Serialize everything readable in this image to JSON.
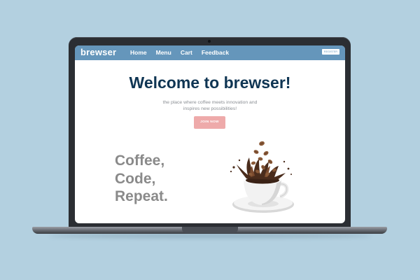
{
  "nav": {
    "brand": "brewser",
    "links": [
      "Home",
      "Menu",
      "Cart",
      "Feedback"
    ],
    "register_label": "REGISTER"
  },
  "hero": {
    "title": "Welcome to brewser!",
    "subtitle_line1": "the place where coffee meets innovation and",
    "subtitle_line2": "inspires new possibilities!",
    "cta_label": "JOIN NOW"
  },
  "slogan": [
    "Coffee,",
    "Code,",
    "Repeat."
  ],
  "colors": {
    "background": "#b3d0e0",
    "navbar": "#6596bb",
    "title": "#0f3553",
    "cta": "#eeaaaa",
    "slogan": "#8a8a8a"
  },
  "icons": {
    "hero_image": "coffee-cup-with-beans-image"
  }
}
